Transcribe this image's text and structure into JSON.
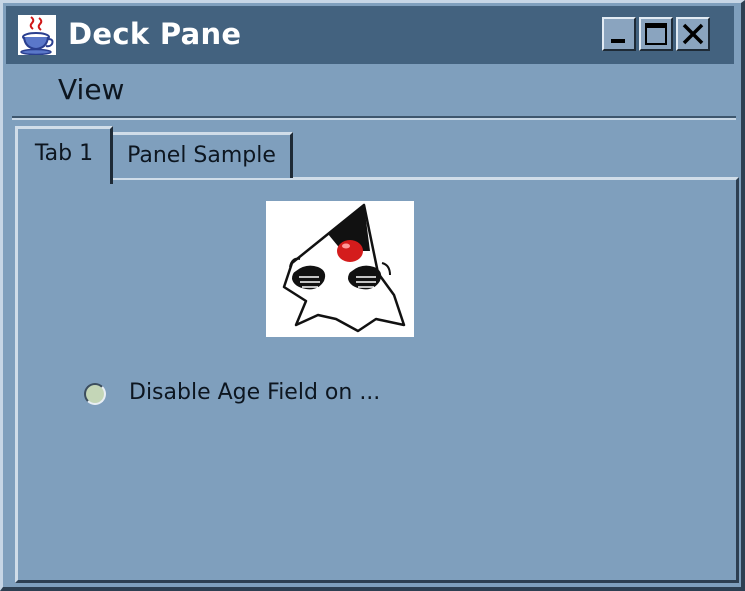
{
  "window": {
    "title": "Deck Pane",
    "title_icon": "java-cup-icon",
    "controls": {
      "minimize": "minimize-icon",
      "maximize": "maximize-icon",
      "close": "close-icon"
    }
  },
  "menubar": {
    "items": [
      {
        "label": "View"
      }
    ]
  },
  "tabs": [
    {
      "label": "Tab 1",
      "selected": true
    },
    {
      "label": "Panel Sample",
      "selected": false
    }
  ],
  "panel": {
    "image": "duke-mascot-image",
    "radio": {
      "label": "Disable Age Field on ...",
      "checked": false
    }
  },
  "colors": {
    "titlebar": "#43627f",
    "background": "#7f9fbd",
    "radio_fill": "#c4d6b7"
  }
}
